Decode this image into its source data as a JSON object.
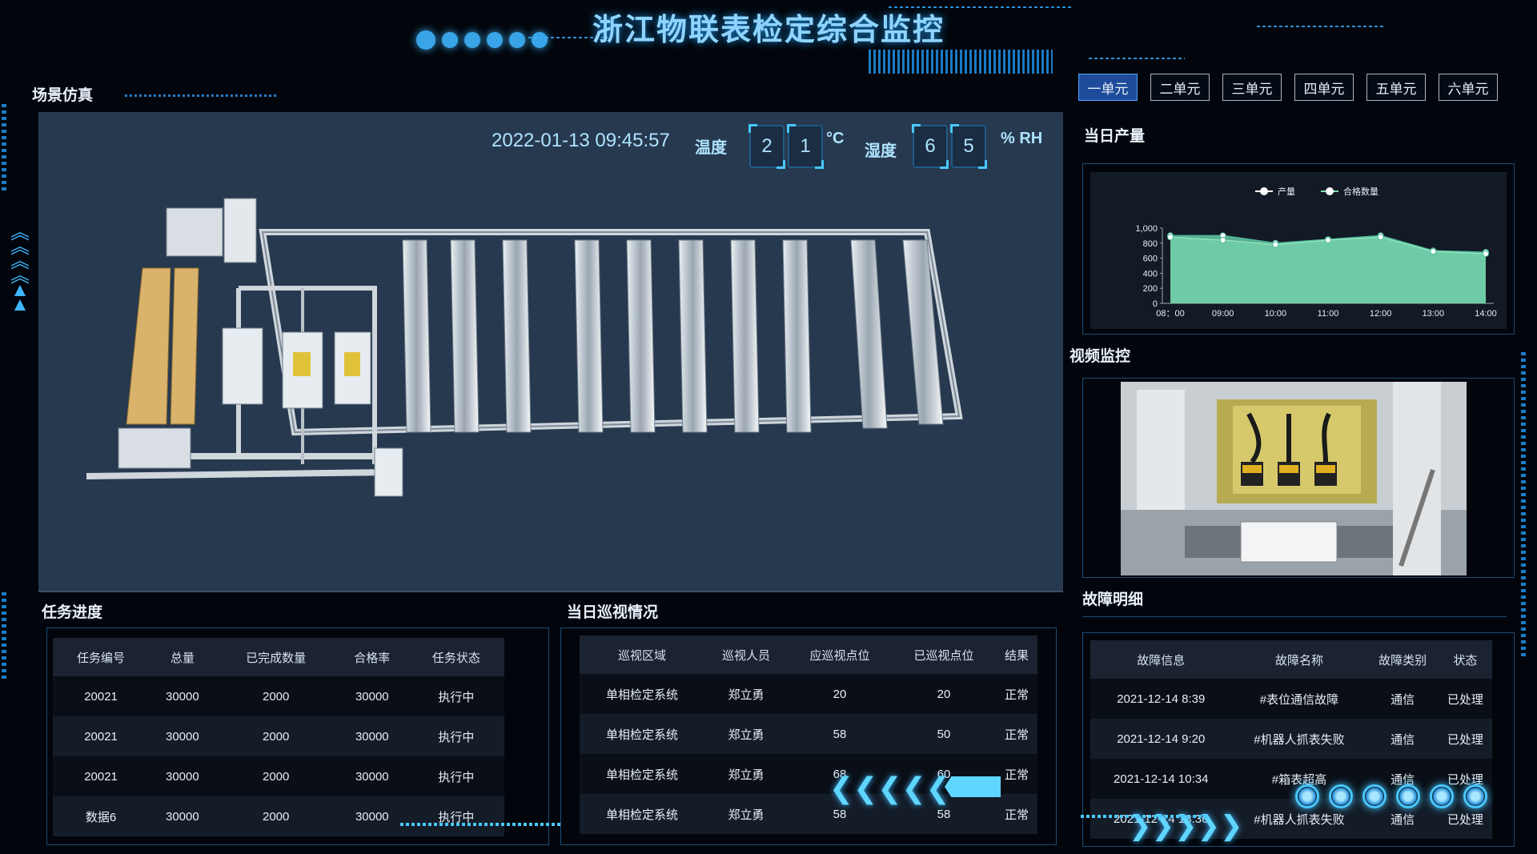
{
  "header": {
    "title": "浙江物联表检定综合监控"
  },
  "simulation": {
    "title": "场景仿真",
    "datetime": "2022-01-13 09:45:57",
    "temperature_label": "温度",
    "temperature_digits": [
      "2",
      "1"
    ],
    "temperature_unit": "°C",
    "humidity_label": "湿度",
    "humidity_digits": [
      "6",
      "5"
    ],
    "humidity_unit": "% RH"
  },
  "units": {
    "tabs": [
      "一单元",
      "二单元",
      "三单元",
      "四单元",
      "五单元",
      "六单元"
    ],
    "active_index": 0
  },
  "production": {
    "title": "当日产量",
    "chart_data": {
      "type": "area",
      "x": [
        "08：00",
        "09:00",
        "10:00",
        "11:00",
        "12:00",
        "13:00",
        "14:00"
      ],
      "series": [
        {
          "name": "产量",
          "values": [
            900,
            900,
            800,
            850,
            900,
            700,
            680
          ],
          "color": "#ffffff"
        },
        {
          "name": "合格数量",
          "values": [
            880,
            840,
            780,
            840,
            880,
            690,
            660
          ],
          "color": "#7fe0b0"
        }
      ],
      "yticks": [
        "0",
        "200",
        "400",
        "600",
        "800",
        "1,000"
      ],
      "ylim": [
        0,
        1000
      ],
      "legend": "top-center",
      "grid": false
    }
  },
  "video": {
    "title": "视频监控"
  },
  "tasks": {
    "title": "任务进度",
    "columns": [
      "任务编号",
      "总量",
      "已完成数量",
      "合格率",
      "任务状态"
    ],
    "rows": [
      [
        "20021",
        "30000",
        "2000",
        "30000",
        "执行中"
      ],
      [
        "20021",
        "30000",
        "2000",
        "30000",
        "执行中"
      ],
      [
        "20021",
        "30000",
        "2000",
        "30000",
        "执行中"
      ],
      [
        "数据6",
        "30000",
        "2000",
        "30000",
        "执行中"
      ]
    ]
  },
  "patrol": {
    "title": "当日巡视情况",
    "columns": [
      "巡视区域",
      "巡视人员",
      "应巡视点位",
      "已巡视点位",
      "结果"
    ],
    "rows": [
      [
        "单相检定系统",
        "郑立勇",
        "20",
        "20",
        "正常"
      ],
      [
        "单相检定系统",
        "郑立勇",
        "58",
        "50",
        "正常"
      ],
      [
        "单相检定系统",
        "郑立勇",
        "68",
        "60",
        "正常"
      ],
      [
        "单相检定系统",
        "郑立勇",
        "58",
        "58",
        "正常"
      ]
    ]
  },
  "faults": {
    "title": "故障明细",
    "columns": [
      "故障信息",
      "故障名称",
      "故障类别",
      "状态"
    ],
    "rows": [
      [
        "2021-12-14 8:39",
        "#表位通信故障",
        "通信",
        "已处理"
      ],
      [
        "2021-12-14 9:20",
        "#机器人抓表失败",
        "通信",
        "已处理"
      ],
      [
        "2021-12-14 10:34",
        "#箱表超高",
        "通信",
        "已处理"
      ],
      [
        "2021-12-14 13:36",
        "#机器人抓表失败",
        "通信",
        "已处理"
      ]
    ]
  }
}
